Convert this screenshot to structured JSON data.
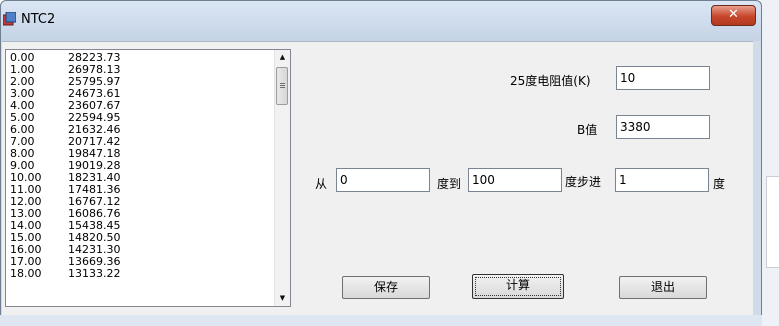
{
  "window": {
    "title": "NTC2",
    "close_glyph": "✕"
  },
  "list": {
    "rows": [
      {
        "temp": "0.00",
        "res": "28223.73"
      },
      {
        "temp": "1.00",
        "res": "26978.13"
      },
      {
        "temp": "2.00",
        "res": "25795.97"
      },
      {
        "temp": "3.00",
        "res": "24673.61"
      },
      {
        "temp": "4.00",
        "res": "23607.67"
      },
      {
        "temp": "5.00",
        "res": "22594.95"
      },
      {
        "temp": "6.00",
        "res": "21632.46"
      },
      {
        "temp": "7.00",
        "res": "20717.42"
      },
      {
        "temp": "8.00",
        "res": "19847.18"
      },
      {
        "temp": "9.00",
        "res": "19019.28"
      },
      {
        "temp": "10.00",
        "res": "18231.40"
      },
      {
        "temp": "11.00",
        "res": "17481.36"
      },
      {
        "temp": "12.00",
        "res": "16767.12"
      },
      {
        "temp": "13.00",
        "res": "16086.76"
      },
      {
        "temp": "14.00",
        "res": "15438.45"
      },
      {
        "temp": "15.00",
        "res": "14820.50"
      },
      {
        "temp": "16.00",
        "res": "14231.30"
      },
      {
        "temp": "17.00",
        "res": "13669.36"
      },
      {
        "temp": "18.00",
        "res": "13133.22"
      }
    ]
  },
  "form": {
    "r25_label": "25度电阻值(K)",
    "r25_value": "10",
    "b_label": "B值",
    "b_value": "3380",
    "from_label": "从",
    "from_value": "0",
    "to_label": "度到",
    "to_value": "100",
    "step_label": "度步进",
    "step_value": "1",
    "unit_label": "度"
  },
  "buttons": {
    "save": "保存",
    "calc": "计算",
    "exit": "退出"
  },
  "icons": {
    "scroll_up": "▲",
    "scroll_down": "▼"
  }
}
